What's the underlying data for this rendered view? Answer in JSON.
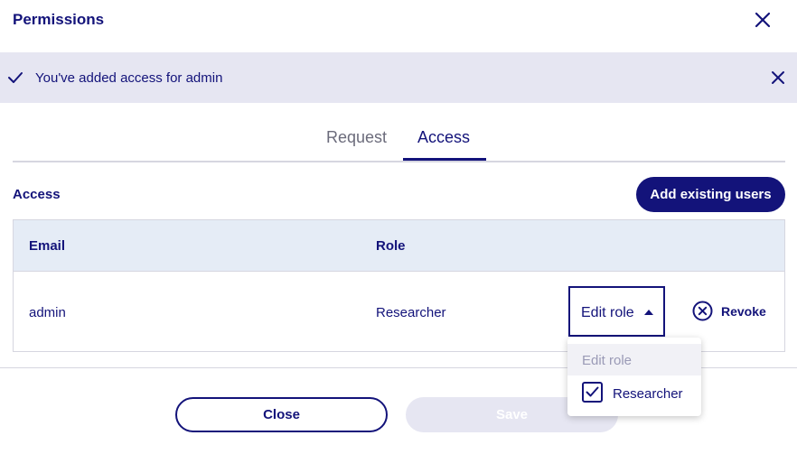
{
  "dialog": {
    "title": "Permissions"
  },
  "banner": {
    "message": "You've added access for admin"
  },
  "tabs": [
    {
      "label": "Request",
      "active": false
    },
    {
      "label": "Access",
      "active": true
    }
  ],
  "access": {
    "section_label": "Access",
    "add_button": "Add existing users"
  },
  "table": {
    "columns": [
      "Email",
      "Role"
    ],
    "rows": [
      {
        "email": "admin",
        "role": "Researcher",
        "edit_role_label": "Edit role",
        "revoke_label": "Revoke"
      }
    ]
  },
  "dropdown": {
    "header": "Edit role",
    "options": [
      {
        "label": "Researcher",
        "checked": true
      }
    ]
  },
  "footer": {
    "close_label": "Close",
    "save_label": "Save"
  },
  "colors": {
    "primary": "#13137a",
    "banner_bg": "#e6e6f2",
    "table_header_bg": "#e5ecf6"
  }
}
